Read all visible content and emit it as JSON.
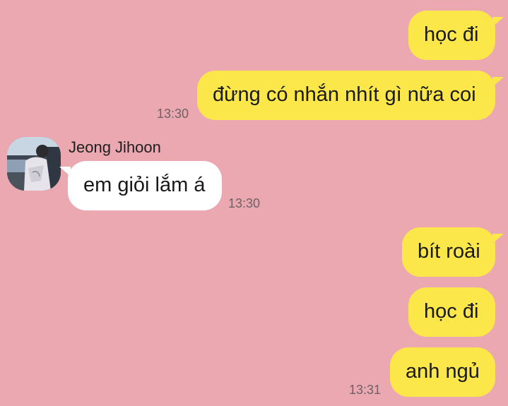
{
  "theme": {
    "background": "#eba8b0",
    "outgoing_bubble": "#fce74a",
    "incoming_bubble": "#ffffff",
    "timestamp_color": "#6f6166"
  },
  "messages": {
    "out_1": {
      "text": "học đi"
    },
    "out_2": {
      "text": "đừng có nhắn nhít gì nữa coi",
      "time": "13:30"
    },
    "in_1": {
      "sender": "Jeong Jihoon",
      "text": "em giỏi lắm á",
      "time": "13:30"
    },
    "out_3": {
      "text": "bít roài"
    },
    "out_4": {
      "text": "học đi"
    },
    "out_5": {
      "text": "anh ngủ",
      "time": "13:31"
    }
  },
  "icons": {
    "avatar": "profile-photo"
  }
}
